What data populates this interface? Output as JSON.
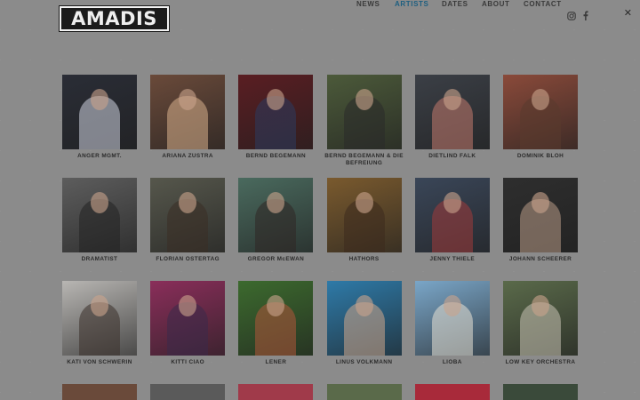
{
  "brand": {
    "logo_text": "AMADIS"
  },
  "nav": {
    "items": [
      {
        "label": "NEWS",
        "active": false
      },
      {
        "label": "ARTISTS",
        "active": true
      },
      {
        "label": "DATES",
        "active": false
      },
      {
        "label": "ABOUT",
        "active": false
      },
      {
        "label": "CONTACT",
        "active": false
      }
    ],
    "social_icons": [
      "instagram-icon",
      "facebook-icon"
    ],
    "close_icon_glyph": "✕"
  },
  "colors": {
    "overlay_gray": "#8b8b8b",
    "active_nav": "#1e5f80",
    "text_dark": "#2b2b2b"
  },
  "artists": [
    {
      "name": "ANGER MGMT.",
      "photo_bg": "#2a2d36",
      "tone": "#cfd3e0"
    },
    {
      "name": "ARIANA ZUSTRA",
      "photo_bg": "#6a4a3a",
      "tone": "#d8b08c"
    },
    {
      "name": "BERND BEGEMANN",
      "photo_bg": "#5a1e22",
      "tone": "#2c3b60"
    },
    {
      "name": "BERND BEGEMANN & DIE BEFREIUNG",
      "photo_bg": "#4c5a3a",
      "tone": "#2a2a2a"
    },
    {
      "name": "DIETLIND FALK",
      "photo_bg": "#3b3f46",
      "tone": "#c27a6e"
    },
    {
      "name": "DOMINIK BLOH",
      "photo_bg": "#8a4a3a",
      "tone": "#5a3b2e"
    },
    {
      "name": "DRAMATIST",
      "photo_bg": "#5d5d5d",
      "tone": "#222222"
    },
    {
      "name": "FLORIAN OSTERTAG",
      "photo_bg": "#56574c",
      "tone": "#3a2e25"
    },
    {
      "name": "GREGOR McEWAN",
      "photo_bg": "#4a6a5e",
      "tone": "#2f2724"
    },
    {
      "name": "HATHORS",
      "photo_bg": "#7a5a2e",
      "tone": "#3c2a1e"
    },
    {
      "name": "JENNY THIELE",
      "photo_bg": "#3a4658",
      "tone": "#a13a3a"
    },
    {
      "name": "JOHANN SCHEERER",
      "photo_bg": "#2e2e2e",
      "tone": "#b89a86"
    },
    {
      "name": "KATI VON SCHWERIN",
      "photo_bg": "#b8b6b3",
      "tone": "#3a2f2a"
    },
    {
      "name": "KITTI CIAO",
      "photo_bg": "#8a2e5a",
      "tone": "#3a2a4a"
    },
    {
      "name": "LENER",
      "photo_bg": "#3c6a2e",
      "tone": "#b0563a"
    },
    {
      "name": "LINUS VOLKMANN",
      "photo_bg": "#2e7aa8",
      "tone": "#d0a88c"
    },
    {
      "name": "LIOBA",
      "photo_bg": "#7aa6c8",
      "tone": "#e8e2d6"
    },
    {
      "name": "LOW KEY ORCHESTRA",
      "photo_bg": "#5a6a4a",
      "tone": "#c9c2b4"
    }
  ],
  "partial_row_colors": [
    "#6a4a3a",
    "#5a5a5a",
    "#a03a4a",
    "#5a6a4a",
    "#a82a3a",
    "#3a4a3a"
  ]
}
